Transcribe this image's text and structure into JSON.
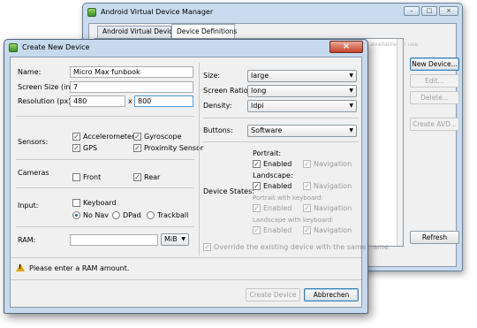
{
  "manager": {
    "title": "Android Virtual Device Manager",
    "tabs": [
      {
        "label": "Android Virtual Devices"
      },
      {
        "label": "Device Definitions"
      }
    ],
    "hidden_text": "The list below shows the device definitions available for use",
    "buttons": {
      "new_device": "New Device...",
      "edit": "Edit...",
      "delete": "Delete...",
      "create_avd": "Create AVD...",
      "refresh": "Refresh"
    },
    "window_controls": [
      "–",
      "□",
      "×"
    ]
  },
  "dialog": {
    "title": "Create New Device",
    "close_glyph": "×",
    "name": {
      "label": "Name:",
      "value": "Micro Max funbook"
    },
    "screen_size": {
      "label": "Screen Size (in):",
      "value": "7"
    },
    "resolution": {
      "label": "Resolution (px):",
      "width": "480",
      "times": "x",
      "height": "800"
    },
    "sensors": {
      "label": "Sensors:",
      "items": [
        {
          "label": "Accelerometer",
          "checked": true
        },
        {
          "label": "Gyroscope",
          "checked": true
        },
        {
          "label": "GPS",
          "checked": true
        },
        {
          "label": "Proximity Sensor",
          "checked": true
        }
      ]
    },
    "cameras": {
      "label": "Cameras",
      "items": [
        {
          "label": "Front",
          "checked": false
        },
        {
          "label": "Rear",
          "checked": true
        }
      ]
    },
    "input": {
      "label": "Input:",
      "keyboard": {
        "label": "Keyboard",
        "checked": false
      },
      "nav_options": [
        {
          "label": "No Nav",
          "selected": true
        },
        {
          "label": "DPad",
          "selected": false
        },
        {
          "label": "Trackball",
          "selected": false
        }
      ]
    },
    "ram": {
      "label": "RAM:",
      "value": "",
      "unit": "MiB"
    },
    "size": {
      "label": "Size:",
      "value": "large"
    },
    "screen_ratio": {
      "label": "Screen Ratio:",
      "value": "long"
    },
    "density": {
      "label": "Density:",
      "value": "ldpi"
    },
    "buttons_field": {
      "label": "Buttons:",
      "value": "Software"
    },
    "device_states": {
      "label": "Device States:",
      "groups": [
        {
          "heading": "Portrait:",
          "enabled": "Enabled",
          "navigation": "Navigation"
        },
        {
          "heading": "Landscape:",
          "enabled": "Enabled",
          "navigation": "Navigation"
        },
        {
          "heading": "Portrait with keyboard:",
          "enabled": "Enabled",
          "navigation": "Navigation"
        },
        {
          "heading": "Landscape with keyboard:",
          "enabled": "Enabled",
          "navigation": "Navigation"
        }
      ]
    },
    "override": "Override the existing device with the same name",
    "warning": "Please enter a RAM amount.",
    "create_button": "Create Device",
    "cancel_button": "Abbrechen",
    "check_glyph": "✓",
    "arrow_glyph": "▼"
  },
  "colors": {
    "window_frame": "#c9dcef",
    "dialog_frame": "#c7d9ec",
    "close_button": "#c7442b",
    "warning": "#e5a300"
  }
}
